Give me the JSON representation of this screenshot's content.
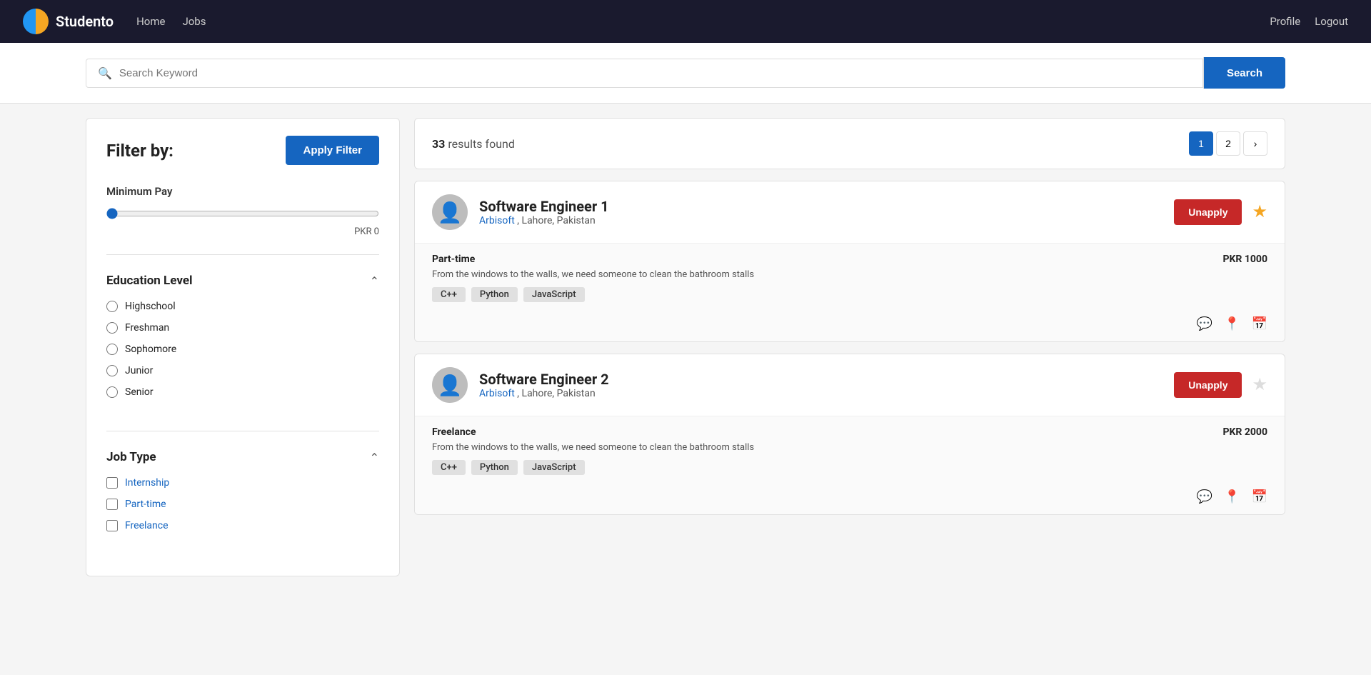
{
  "navbar": {
    "brand": "Studento",
    "links": [
      "Home",
      "Jobs"
    ],
    "right": [
      "Profile",
      "Logout"
    ]
  },
  "search": {
    "placeholder": "Search Keyword",
    "button_label": "Search"
  },
  "filter": {
    "title": "Filter by:",
    "apply_label": "Apply Filter",
    "min_pay": {
      "label": "Minimum Pay",
      "value": 0,
      "display": "PKR 0"
    },
    "education": {
      "title": "Education Level",
      "options": [
        "Highschool",
        "Freshman",
        "Sophomore",
        "Junior",
        "Senior"
      ]
    },
    "job_type": {
      "title": "Job Type",
      "options": [
        "Internship",
        "Part-time",
        "Freelance"
      ]
    }
  },
  "results": {
    "count": "33",
    "count_label": "results found",
    "pagination": {
      "current": 1,
      "pages": [
        1,
        2
      ],
      "next_label": "›"
    }
  },
  "jobs": [
    {
      "id": 1,
      "title": "Software Engineer 1",
      "company": "Arbisoft",
      "location": "Lahore, Pakistan",
      "type": "Part-time",
      "description": "From the windows to the walls, we need someone to clean the bathroom stalls",
      "pay": "PKR 1000",
      "tags": [
        "C++",
        "Python",
        "JavaScript"
      ],
      "applied": true,
      "bookmarked": true
    },
    {
      "id": 2,
      "title": "Software Engineer 2",
      "company": "Arbisoft",
      "location": "Lahore, Pakistan",
      "type": "Freelance",
      "description": "From the windows to the walls, we need someone to clean the bathroom stalls",
      "pay": "PKR 2000",
      "tags": [
        "C++",
        "Python",
        "JavaScript"
      ],
      "applied": true,
      "bookmarked": false
    }
  ]
}
